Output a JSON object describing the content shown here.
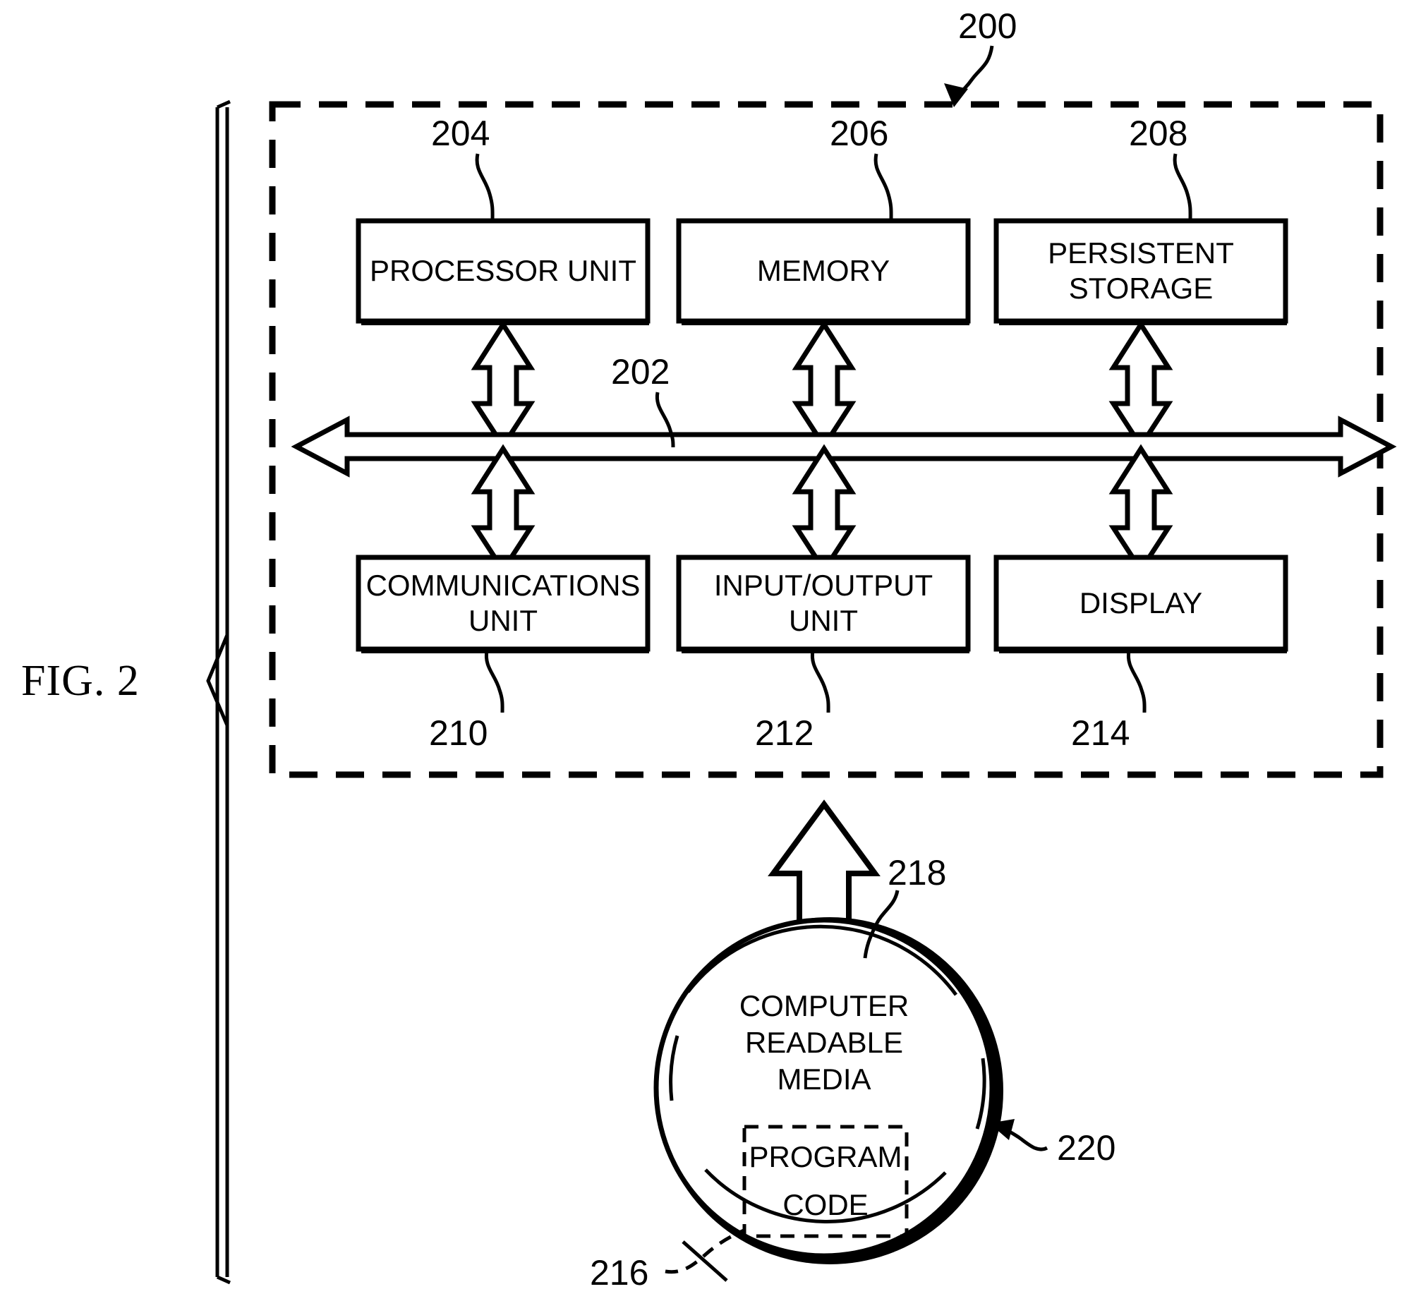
{
  "figure": {
    "title": "FIG. 2",
    "system_ref": "200",
    "bus_ref": "202"
  },
  "boxes": {
    "processor_unit": {
      "label": "PROCESSOR UNIT",
      "ref": "204"
    },
    "memory": {
      "label": "MEMORY",
      "ref": "206"
    },
    "persistent_storage": {
      "label": "PERSISTENT\nSTORAGE",
      "ref": "208"
    },
    "communications_unit": {
      "label": "COMMUNICATIONS\nUNIT",
      "ref": "210"
    },
    "input_output_unit": {
      "label": "INPUT/OUTPUT\nUNIT",
      "ref": "212"
    },
    "display": {
      "label": "DISPLAY",
      "ref": "214"
    }
  },
  "media": {
    "disc_label": "COMPUTER\nREADABLE\nMEDIA",
    "disc_ref": "218",
    "program_code_label": "PROGRAM\nCODE",
    "program_code_ref": "216",
    "product_ref": "220"
  },
  "colors": {
    "ink": "#000000",
    "paper": "#ffffff"
  }
}
